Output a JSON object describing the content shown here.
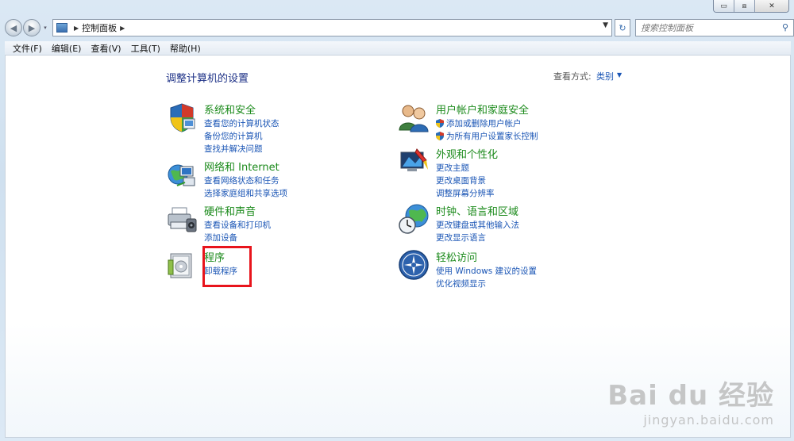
{
  "window": {
    "minimize_label": "▭",
    "maximize_label": "⧈",
    "close_label": "✕"
  },
  "nav": {
    "back_label": "◀",
    "forward_label": "▶",
    "dropdown_label": "▾",
    "address_segment": "控制面板",
    "address_arrow": "▶",
    "address_dropdown": "▼",
    "refresh_label": "↻",
    "search_placeholder": "搜索控制面板",
    "search_icon_label": "⚲"
  },
  "menubar": {
    "items": [
      "文件(F)",
      "编辑(E)",
      "查看(V)",
      "工具(T)",
      "帮助(H)"
    ]
  },
  "content": {
    "title": "调整计算机的设置",
    "view_by_label": "查看方式:",
    "view_by_value": "类别",
    "view_by_dropdown": "▼"
  },
  "categories": [
    {
      "title": "系统和安全",
      "links": [
        "查看您的计算机状态",
        "备份您的计算机",
        "查找并解决问题"
      ]
    },
    {
      "title": "网络和 Internet",
      "links": [
        "查看网络状态和任务",
        "选择家庭组和共享选项"
      ]
    },
    {
      "title": "硬件和声音",
      "links": [
        "查看设备和打印机",
        "添加设备"
      ]
    },
    {
      "title": "程序",
      "links": [
        "卸载程序"
      ]
    },
    {
      "title": "用户帐户和家庭安全",
      "links": [
        "添加或删除用户帐户",
        "为所有用户设置家长控制"
      ]
    },
    {
      "title": "外观和个性化",
      "links": [
        "更改主题",
        "更改桌面背景",
        "调整屏幕分辨率"
      ]
    },
    {
      "title": "时钟、语言和区域",
      "links": [
        "更改键盘或其他输入法",
        "更改显示语言"
      ]
    },
    {
      "title": "轻松访问",
      "links": [
        "使用 Windows 建议的设置",
        "优化视频显示"
      ]
    }
  ],
  "watermark": {
    "logo": "Bai du 经验",
    "sub": "jingyan.baidu.com"
  }
}
